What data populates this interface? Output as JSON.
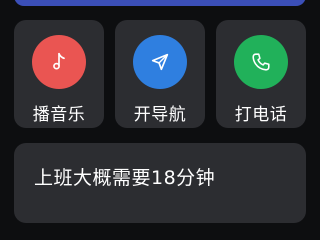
{
  "colors": {
    "background": "#0d0e10",
    "tile": "#2c2d31",
    "top_bar": "#3b4fb8",
    "music": "#ea5552",
    "navigation": "#2f7fe0",
    "call": "#21b15a",
    "text": "#ffffff"
  },
  "shortcuts": [
    {
      "label": "播音乐",
      "icon": "music-note-icon",
      "color": "#ea5552"
    },
    {
      "label": "开导航",
      "icon": "navigation-arrow-icon",
      "color": "#2f7fe0"
    },
    {
      "label": "打电话",
      "icon": "phone-icon",
      "color": "#21b15a"
    }
  ],
  "commute": {
    "text": "上班大概需要18分钟"
  }
}
